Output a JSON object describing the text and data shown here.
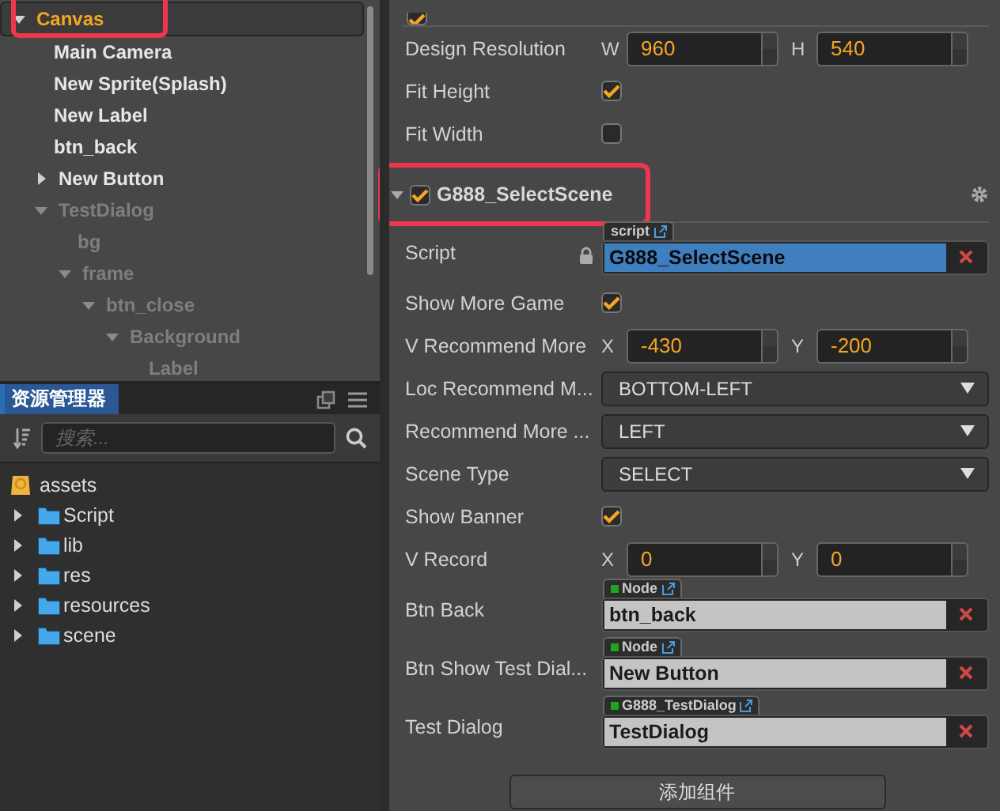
{
  "hierarchy": {
    "items": [
      {
        "label": "Canvas",
        "selected": true,
        "dimmed": false,
        "expanded": true,
        "children": [
          {
            "label": "Main Camera",
            "selected": false,
            "dimmed": false
          },
          {
            "label": "New Sprite(Splash)",
            "selected": false,
            "dimmed": false
          },
          {
            "label": "New Label",
            "selected": false,
            "dimmed": false
          },
          {
            "label": "btn_back",
            "selected": false,
            "dimmed": false
          },
          {
            "label": "New Button",
            "selected": false,
            "dimmed": false,
            "expanded": false
          },
          {
            "label": "TestDialog",
            "selected": false,
            "dimmed": true,
            "expanded": true,
            "children": [
              {
                "label": "bg",
                "selected": false,
                "dimmed": true
              },
              {
                "label": "frame",
                "selected": false,
                "dimmed": true,
                "expanded": true,
                "children": [
                  {
                    "label": "btn_close",
                    "selected": false,
                    "dimmed": true,
                    "expanded": true,
                    "children": [
                      {
                        "label": "Background",
                        "selected": false,
                        "dimmed": true,
                        "expanded": true,
                        "children": [
                          {
                            "label": "Label",
                            "selected": false,
                            "dimmed": true
                          }
                        ]
                      }
                    ]
                  }
                ]
              }
            ]
          }
        ]
      }
    ]
  },
  "assets": {
    "tabs": [
      {
        "label": "资源管理器",
        "selected": true
      }
    ],
    "search": {
      "placeholder": "搜索..."
    },
    "root": {
      "label": "assets",
      "children": [
        {
          "label": "Script",
          "expanded": false
        },
        {
          "label": "lib",
          "expanded": false
        },
        {
          "label": "res",
          "expanded": false
        },
        {
          "label": "resources",
          "expanded": false
        },
        {
          "label": "scene",
          "expanded": false
        }
      ]
    }
  },
  "inspector": {
    "top_component": {
      "enabled": true
    },
    "canvas_props": [
      {
        "kind": "vec2",
        "label": "Design Resolution",
        "a_label": "W",
        "a": "960",
        "b_label": "H",
        "b": "540"
      },
      {
        "kind": "check",
        "label": "Fit Height",
        "checked": true
      },
      {
        "kind": "check",
        "label": "Fit Width",
        "checked": false
      }
    ],
    "component": {
      "name": "G888_SelectScene",
      "enabled": true,
      "expanded": true
    },
    "props": [
      {
        "kind": "script",
        "label": "Script",
        "tag": "script",
        "value": "G888_SelectScene"
      },
      {
        "kind": "check",
        "label": "Show More Game",
        "checked": true
      },
      {
        "kind": "vec2",
        "label": "V Recommend More",
        "a_label": "X",
        "a": "-430",
        "b_label": "Y",
        "b": "-200"
      },
      {
        "kind": "select",
        "label": "Loc Recommend M...",
        "value": "BOTTOM-LEFT"
      },
      {
        "kind": "select",
        "label": "Recommend More ...",
        "value": "LEFT"
      },
      {
        "kind": "select",
        "label": "Scene Type",
        "value": "SELECT"
      },
      {
        "kind": "check",
        "label": "Show Banner",
        "checked": true
      },
      {
        "kind": "vec2",
        "label": "V Record",
        "a_label": "X",
        "a": "0",
        "b_label": "Y",
        "b": "0"
      },
      {
        "kind": "object",
        "label": "Btn Back",
        "tag": "Node",
        "value": "btn_back"
      },
      {
        "kind": "object",
        "label": "Btn Show Test Dial...",
        "tag": "Node",
        "value": "New Button"
      },
      {
        "kind": "object",
        "label": "Test Dialog",
        "tag": "G888_TestDialog",
        "value": "TestDialog"
      }
    ],
    "add_button": "添加组件"
  }
}
